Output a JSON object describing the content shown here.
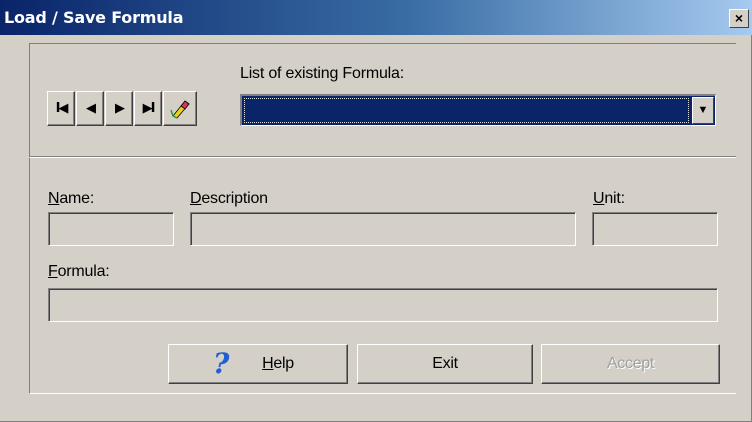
{
  "window": {
    "title": "Load / Save Formula",
    "close_glyph": "×"
  },
  "navigator": {
    "first_glyph": "I◀",
    "prev_glyph": "◀",
    "next_glyph": "▶",
    "last_glyph": "▶I",
    "edit_icon": "pencil-eraser-icon"
  },
  "formula_list": {
    "label": "List of existing Formula:",
    "selected_value": "",
    "arrow_glyph": "▼"
  },
  "fields": {
    "name_label": "Name:",
    "name_accel": "N",
    "name_rest": "ame:",
    "name_value": "",
    "description_label": "Description",
    "description_accel": "D",
    "description_rest": "escription",
    "description_value": "",
    "unit_label": "Unit:",
    "unit_accel": "U",
    "unit_rest": "nit:",
    "unit_value": "",
    "formula_label": "Formula:",
    "formula_accel": "F",
    "formula_rest": "ormula:",
    "formula_value": ""
  },
  "buttons": {
    "help_label": "Help",
    "help_accel": "H",
    "help_rest": "elp",
    "help_icon": "question-mark-icon",
    "help_glyph": "?",
    "exit_label": "Exit",
    "accept_label": "Accept"
  },
  "colors": {
    "titlebar_start": "#0a246a",
    "titlebar_end": "#a6caf0",
    "dialog_face": "#d4d0c8",
    "selection": "#0a246a"
  }
}
